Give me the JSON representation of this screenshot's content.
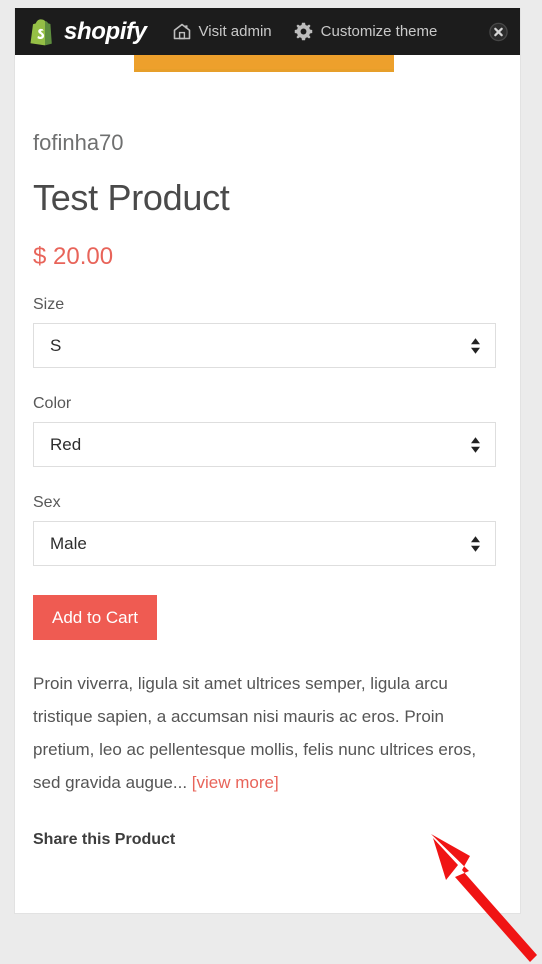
{
  "admin_bar": {
    "brand": "shopify",
    "brand_icon": "shopify-bag-icon",
    "links": [
      {
        "label": "Visit admin",
        "icon": "home-icon"
      },
      {
        "label": "Customize theme",
        "icon": "gear-icon"
      }
    ],
    "close_icon": "close-circle-icon"
  },
  "product": {
    "vendor": "fofinha70",
    "title": "Test Product",
    "price": "$ 20.00",
    "options": [
      {
        "label": "Size",
        "value": "S"
      },
      {
        "label": "Color",
        "value": "Red"
      },
      {
        "label": "Sex",
        "value": "Male"
      }
    ],
    "add_to_cart_label": "Add to Cart",
    "description": "Proin viverra, ligula sit amet ultrices semper, ligula arcu tristique sapien, a accumsan nisi mauris ac eros. Proin pretium, leo ac pellentesque mollis, felis nunc ultrices eros, sed gravida augue...",
    "view_more_label": "[view more]",
    "share_heading": "Share this Product"
  },
  "annotation": {
    "arrow_color": "#f01414",
    "arrow_icon": "red-pointer-arrow"
  },
  "colors": {
    "accent": "#ef5b52",
    "price": "#e8645a",
    "admin_bar_bg": "#1c1c1c",
    "media_strip": "#eda02c",
    "page_bg": "#ebebeb"
  }
}
